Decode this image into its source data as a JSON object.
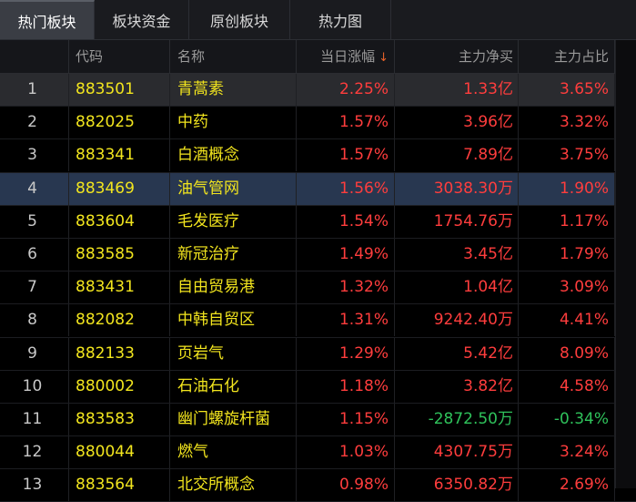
{
  "tabs": [
    {
      "label": "热门板块",
      "active": true
    },
    {
      "label": "板块资金",
      "active": false
    },
    {
      "label": "原创板块",
      "active": false
    },
    {
      "label": "热力图",
      "active": false
    }
  ],
  "columns": {
    "idx": "",
    "code": "代码",
    "name": "名称",
    "change": "当日涨幅",
    "sort_icon": "↓",
    "net_buy": "主力净买",
    "ratio": "主力占比"
  },
  "rows": [
    {
      "idx": "1",
      "code": "883501",
      "name": "青蒿素",
      "change": "2.25%",
      "net_buy": "1.33亿",
      "ratio": "3.65%"
    },
    {
      "idx": "2",
      "code": "882025",
      "name": "中药",
      "change": "1.57%",
      "net_buy": "3.96亿",
      "ratio": "3.32%"
    },
    {
      "idx": "3",
      "code": "883341",
      "name": "白酒概念",
      "change": "1.57%",
      "net_buy": "7.89亿",
      "ratio": "3.75%"
    },
    {
      "idx": "4",
      "code": "883469",
      "name": "油气管网",
      "change": "1.56%",
      "net_buy": "3038.30万",
      "ratio": "1.90%"
    },
    {
      "idx": "5",
      "code": "883604",
      "name": "毛发医疗",
      "change": "1.54%",
      "net_buy": "1754.76万",
      "ratio": "1.17%"
    },
    {
      "idx": "6",
      "code": "883585",
      "name": "新冠治疗",
      "change": "1.49%",
      "net_buy": "3.45亿",
      "ratio": "1.79%"
    },
    {
      "idx": "7",
      "code": "883431",
      "name": "自由贸易港",
      "change": "1.32%",
      "net_buy": "1.04亿",
      "ratio": "3.09%"
    },
    {
      "idx": "8",
      "code": "882082",
      "name": "中韩自贸区",
      "change": "1.31%",
      "net_buy": "9242.40万",
      "ratio": "4.41%"
    },
    {
      "idx": "9",
      "code": "882133",
      "name": "页岩气",
      "change": "1.29%",
      "net_buy": "5.42亿",
      "ratio": "8.09%"
    },
    {
      "idx": "10",
      "code": "880002",
      "name": "石油石化",
      "change": "1.18%",
      "net_buy": "3.82亿",
      "ratio": "4.58%"
    },
    {
      "idx": "11",
      "code": "883583",
      "name": "幽门螺旋杆菌",
      "change": "1.15%",
      "net_buy": "-2872.50万",
      "ratio": "-0.34%"
    },
    {
      "idx": "12",
      "code": "880044",
      "name": "燃气",
      "change": "1.03%",
      "net_buy": "4307.75万",
      "ratio": "3.24%"
    },
    {
      "idx": "13",
      "code": "883564",
      "name": "北交所概念",
      "change": "0.98%",
      "net_buy": "6350.82万",
      "ratio": "2.69%"
    }
  ],
  "colors": {
    "positive": "#ff3d3d",
    "negative": "#2fc25b",
    "code_name": "#f2e51e",
    "selected_row": "#283750"
  }
}
